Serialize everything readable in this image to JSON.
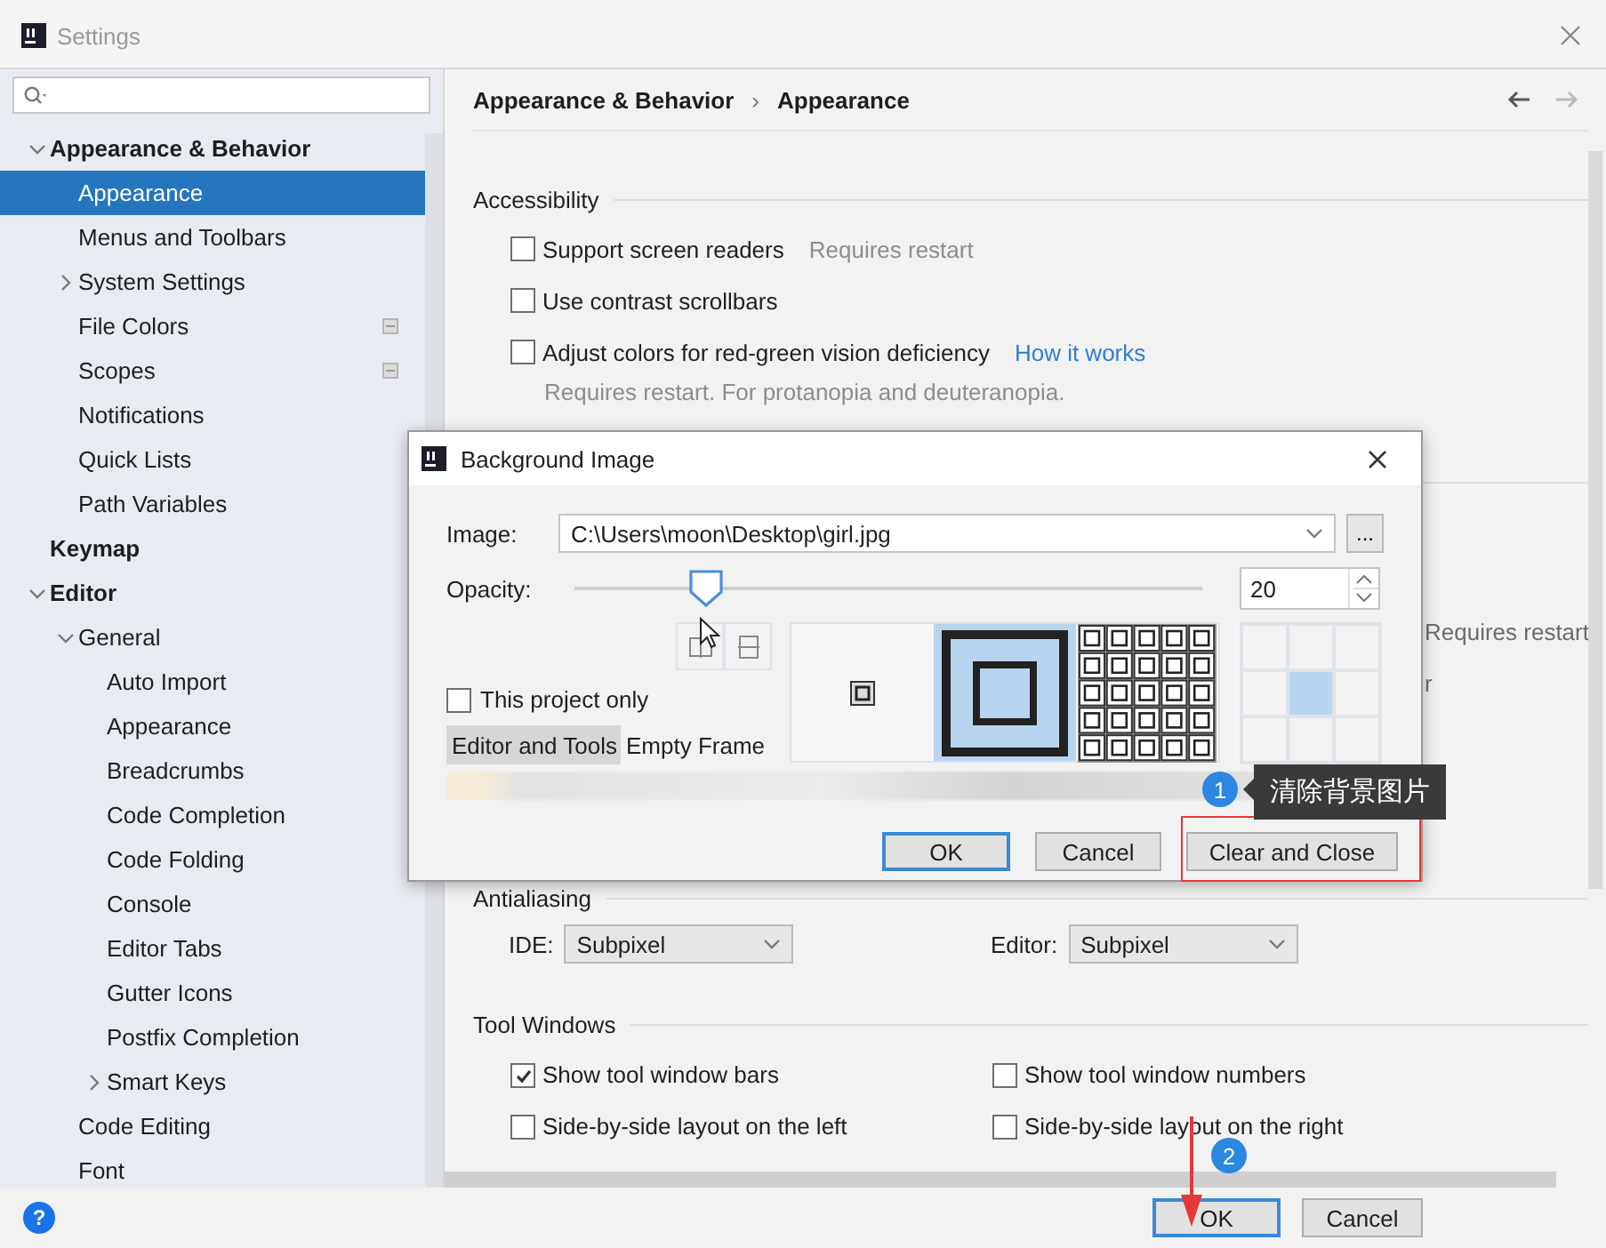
{
  "window": {
    "title": "Settings"
  },
  "sidebar": {
    "items": [
      {
        "label": "Appearance & Behavior",
        "kind": "group",
        "expanded": true,
        "selected": false,
        "children": [
          {
            "label": "Appearance",
            "kind": "page",
            "selected": true
          },
          {
            "label": "Menus and Toolbars",
            "kind": "page",
            "selected": false
          },
          {
            "label": "System Settings",
            "kind": "page",
            "expanded": false,
            "selected": false
          },
          {
            "label": "File Colors",
            "kind": "shared",
            "selected": false
          },
          {
            "label": "Scopes",
            "kind": "shared",
            "selected": false
          },
          {
            "label": "Notifications",
            "kind": "page",
            "selected": false
          },
          {
            "label": "Quick Lists",
            "kind": "page",
            "selected": false
          },
          {
            "label": "Path Variables",
            "kind": "page",
            "selected": false
          }
        ]
      },
      {
        "label": "Keymap",
        "kind": "group",
        "selected": false
      },
      {
        "label": "Editor",
        "kind": "group",
        "expanded": true,
        "selected": false,
        "children": [
          {
            "label": "General",
            "kind": "page",
            "expanded": true,
            "selected": false,
            "children": [
              {
                "label": "Auto Import",
                "kind": "page",
                "selected": false
              },
              {
                "label": "Appearance",
                "kind": "page",
                "selected": false
              },
              {
                "label": "Breadcrumbs",
                "kind": "page",
                "selected": false
              },
              {
                "label": "Code Completion",
                "kind": "page",
                "selected": false
              },
              {
                "label": "Code Folding",
                "kind": "page",
                "selected": false
              },
              {
                "label": "Console",
                "kind": "page",
                "selected": false
              },
              {
                "label": "Editor Tabs",
                "kind": "page",
                "selected": false
              },
              {
                "label": "Gutter Icons",
                "kind": "page",
                "selected": false
              },
              {
                "label": "Postfix Completion",
                "kind": "page",
                "selected": false
              },
              {
                "label": "Smart Keys",
                "kind": "page",
                "expanded": false,
                "selected": false
              }
            ]
          },
          {
            "label": "Code Editing",
            "kind": "page",
            "selected": false
          },
          {
            "label": "Font",
            "kind": "page",
            "selected": false
          }
        ]
      }
    ]
  },
  "breadcrumb": {
    "path": [
      "Appearance & Behavior",
      "Appearance"
    ],
    "separator": "›",
    "back": {
      "disabled": false
    },
    "forward": {
      "disabled": true
    }
  },
  "accessibility": {
    "title": "Accessibility",
    "options": [
      {
        "label": "Support screen readers",
        "checked": false,
        "note": "Requires restart"
      },
      {
        "label": "Use contrast scrollbars",
        "checked": false
      },
      {
        "label": "Adjust colors for red-green vision deficiency",
        "checked": false,
        "link": "How it works",
        "hint": "Requires restart. For protanopia and deuteranopia."
      }
    ]
  },
  "ui_options_fragments": [
    "Requires restart",
    "r"
  ],
  "antialiasing": {
    "title": "Antialiasing",
    "combos": [
      {
        "label": "IDE:",
        "value": "Subpixel"
      },
      {
        "label": "Editor:",
        "value": "Subpixel"
      }
    ]
  },
  "tool_windows": {
    "title": "Tool Windows",
    "options": [
      {
        "label": "Show tool window bars",
        "checked": true
      },
      {
        "label": "Show tool window numbers",
        "checked": false
      },
      {
        "label": "Side-by-side layout on the left",
        "checked": false
      },
      {
        "label": "Side-by-side layout on the right",
        "checked": false
      }
    ]
  },
  "footer": {
    "help": "?",
    "buttons": [
      {
        "label": "OK",
        "default": true
      },
      {
        "label": "Cancel",
        "default": false
      }
    ]
  },
  "dialog": {
    "title": "Background Image",
    "image_label": "Image:",
    "image_path": "C:\\Users\\moon\\Desktop\\girl.jpg",
    "browse": "...",
    "opacity_label": "Opacity:",
    "opacity": {
      "level": 0.21
    },
    "opacity_value": "20",
    "this_project_only": {
      "label": "This project only",
      "checked": false
    },
    "tabs": [
      {
        "label": "Editor and Tools",
        "selected": true
      },
      {
        "label": "Empty Frame",
        "selected": false
      }
    ],
    "fill_modes": [
      {
        "kind": "center",
        "selected": false
      },
      {
        "kind": "scale",
        "selected": true
      },
      {
        "kind": "tile",
        "selected": false
      }
    ],
    "anchors": [
      {
        "selected": false
      },
      {
        "selected": false
      },
      {
        "selected": false
      },
      {
        "selected": false
      },
      {
        "selected": true
      },
      {
        "selected": false
      },
      {
        "selected": false
      },
      {
        "selected": false
      },
      {
        "selected": false
      }
    ],
    "buttons": [
      {
        "label": "OK",
        "default": true
      },
      {
        "label": "Cancel",
        "default": false
      },
      {
        "label": "Clear and Close",
        "default": false
      }
    ]
  },
  "annotations": {
    "callouts": [
      {
        "number": "1",
        "tooltip": "清除背景图片"
      },
      {
        "number": "2"
      }
    ]
  }
}
